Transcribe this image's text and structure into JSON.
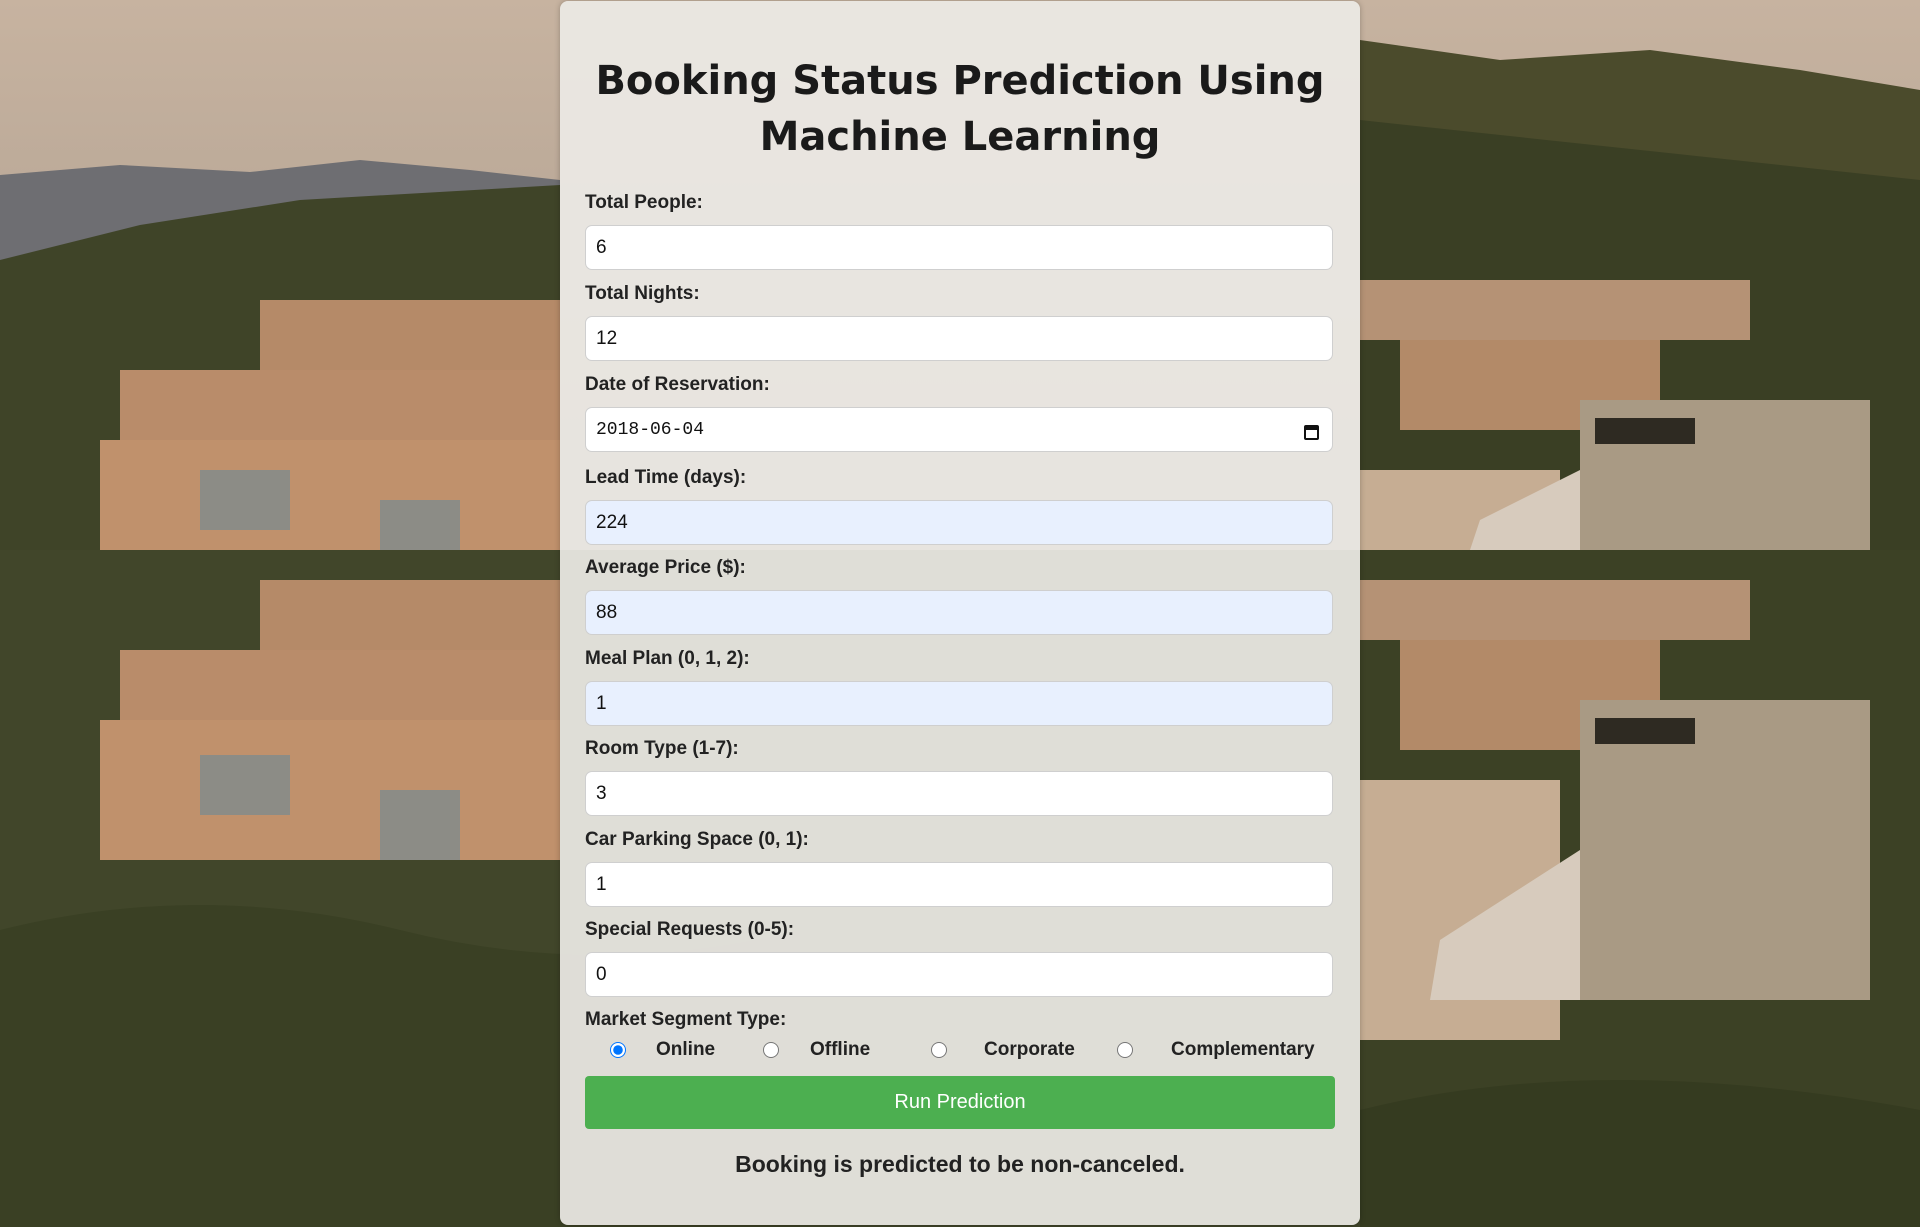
{
  "page": {
    "title": "Booking Status Prediction Using Machine Learning"
  },
  "form": {
    "fields": [
      {
        "label": "Total People:",
        "value": "6"
      },
      {
        "label": "Total Nights:",
        "value": "12"
      },
      {
        "label": "Date of Reservation:",
        "value": "2018-06-04"
      },
      {
        "label": "Lead Time (days):",
        "value": "224"
      },
      {
        "label": "Average Price ($):",
        "value": "88"
      },
      {
        "label": "Meal Plan (0, 1, 2):",
        "value": "1"
      },
      {
        "label": "Room Type (1-7):",
        "value": "3"
      },
      {
        "label": "Car Parking Space (0, 1):",
        "value": "1"
      },
      {
        "label": "Special Requests (0-5):",
        "value": "0"
      }
    ],
    "market_segment": {
      "label": "Market Segment Type:",
      "options": [
        "Online",
        "Offline",
        "Corporate",
        "Complementary"
      ],
      "selected": "Online"
    },
    "submit_label": "Run Prediction"
  },
  "result": {
    "text": "Booking is predicted to be non-canceled."
  },
  "colors": {
    "button": "#4caf50",
    "autofill": "#e8f0fe"
  }
}
